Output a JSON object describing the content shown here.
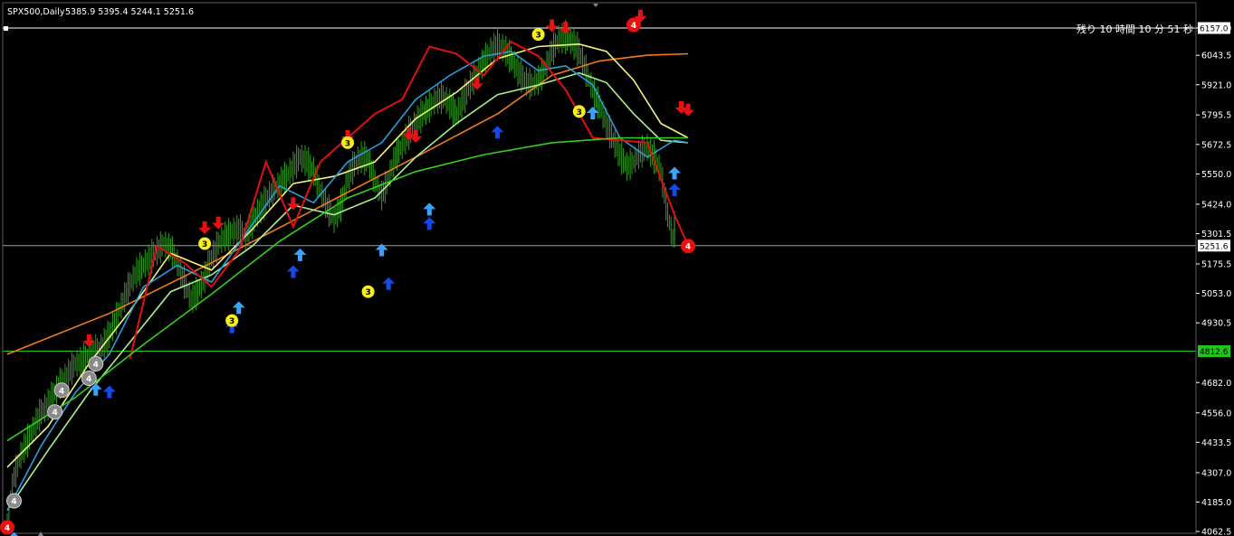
{
  "header": {
    "symbol": "SPX500,Daily",
    "ohlc": "5385.9 5395.4 5244.1 5251.6"
  },
  "timer": {
    "label": "残り 10 時間 10 分 51 秒"
  },
  "colors": {
    "background": "#000000",
    "bar": "#2f9e1c",
    "ma_orange": "#f07c1e",
    "ma_yellow": "#f5f27a",
    "ma_lightgreen": "#a8f08a",
    "ma_green": "#33d11a",
    "ma_blue": "#2a9de0",
    "ma_red": "#e01010",
    "arrow_up_light": "#3aa2ff",
    "arrow_up_dark": "#1448e8",
    "arrow_down": "#e81010",
    "badge_yellow": "#f7ef1a",
    "badge_red": "#e81010",
    "badge_gray": "#8a8a8a",
    "hline_gray": "#8ea6b8",
    "hline_green": "#22c51c"
  },
  "chart_data": {
    "type": "line",
    "title": "SPX500,Daily",
    "ylim": [
      4040,
      6200
    ],
    "y_ticks": [
      "6157.0",
      "6043.5",
      "5921.0",
      "5795.5",
      "5672.5",
      "5550.0",
      "5424.0",
      "5301.5",
      "5175.5",
      "5053.0",
      "4930.5",
      "4682.0",
      "4556.0",
      "4433.5",
      "4307.0",
      "4185.0",
      "4062.5"
    ],
    "price_tags": [
      {
        "label": "6157.0",
        "value": 6157.0,
        "style": "white"
      },
      {
        "label": "5251.6",
        "value": 5251.6,
        "style": "white"
      },
      {
        "label": "4812.6",
        "value": 4812.6,
        "style": "green"
      }
    ],
    "horizontal_lines": [
      {
        "value": 6157.0,
        "color": "#ffffff"
      },
      {
        "value": 5251.6,
        "color": "#8ea6b8"
      },
      {
        "value": 4812.6,
        "color": "#22c51c"
      }
    ],
    "close_series": [
      4110,
      4290,
      4380,
      4440,
      4500,
      4560,
      4590,
      4640,
      4690,
      4720,
      4760,
      4770,
      4800,
      4810,
      4830,
      4880,
      4950,
      5020,
      5090,
      5140,
      5170,
      5200,
      5230,
      5260,
      5240,
      5180,
      5100,
      5030,
      5060,
      5120,
      5200,
      5260,
      5290,
      5310,
      5320,
      5290,
      5350,
      5400,
      5440,
      5480,
      5510,
      5540,
      5580,
      5620,
      5600,
      5560,
      5480,
      5410,
      5360,
      5420,
      5530,
      5590,
      5620,
      5610,
      5520,
      5460,
      5530,
      5620,
      5670,
      5720,
      5760,
      5800,
      5830,
      5860,
      5870,
      5840,
      5800,
      5860,
      5920,
      5970,
      6020,
      6060,
      6090,
      6070,
      6030,
      5980,
      5940,
      5920,
      5940,
      5990,
      6060,
      6110,
      6120,
      6100,
      6060,
      5980,
      5900,
      5830,
      5760,
      5690,
      5630,
      5580,
      5600,
      5640,
      5660,
      5620,
      5560,
      5380,
      5251.6
    ],
    "series": [
      {
        "key": "ma_orange",
        "values": [
          [
            0,
            4800
          ],
          [
            15,
            4970
          ],
          [
            30,
            5180
          ],
          [
            45,
            5400
          ],
          [
            60,
            5620
          ],
          [
            72,
            5800
          ],
          [
            80,
            5960
          ],
          [
            87,
            6020
          ],
          [
            94,
            6044
          ],
          [
            100,
            6050
          ]
        ]
      },
      {
        "key": "ma_yellow",
        "values": [
          [
            0,
            4330
          ],
          [
            6,
            4500
          ],
          [
            12,
            4760
          ],
          [
            18,
            4980
          ],
          [
            24,
            5220
          ],
          [
            30,
            5150
          ],
          [
            36,
            5320
          ],
          [
            42,
            5510
          ],
          [
            48,
            5540
          ],
          [
            54,
            5600
          ],
          [
            60,
            5780
          ],
          [
            66,
            5890
          ],
          [
            72,
            6030
          ],
          [
            78,
            6080
          ],
          [
            84,
            6090
          ],
          [
            88,
            6060
          ],
          [
            92,
            5940
          ],
          [
            96,
            5760
          ],
          [
            100,
            5700
          ]
        ]
      },
      {
        "key": "ma_lightgreen",
        "values": [
          [
            0,
            4150
          ],
          [
            6,
            4400
          ],
          [
            12,
            4640
          ],
          [
            18,
            4850
          ],
          [
            24,
            5060
          ],
          [
            30,
            5130
          ],
          [
            36,
            5250
          ],
          [
            42,
            5420
          ],
          [
            48,
            5380
          ],
          [
            54,
            5450
          ],
          [
            60,
            5620
          ],
          [
            66,
            5760
          ],
          [
            72,
            5880
          ],
          [
            78,
            5920
          ],
          [
            84,
            5970
          ],
          [
            88,
            5930
          ],
          [
            92,
            5800
          ],
          [
            96,
            5690
          ],
          [
            100,
            5680
          ]
        ]
      },
      {
        "key": "ma_blue",
        "values": [
          [
            0,
            4150
          ],
          [
            5,
            4420
          ],
          [
            10,
            4640
          ],
          [
            15,
            4800
          ],
          [
            20,
            5080
          ],
          [
            25,
            5170
          ],
          [
            30,
            5100
          ],
          [
            35,
            5300
          ],
          [
            40,
            5500
          ],
          [
            45,
            5430
          ],
          [
            50,
            5600
          ],
          [
            55,
            5680
          ],
          [
            60,
            5860
          ],
          [
            65,
            5960
          ],
          [
            70,
            6040
          ],
          [
            74,
            6060
          ],
          [
            78,
            5980
          ],
          [
            82,
            6000
          ],
          [
            86,
            5920
          ],
          [
            90,
            5700
          ],
          [
            94,
            5620
          ],
          [
            98,
            5690
          ],
          [
            100,
            5680
          ]
        ]
      },
      {
        "key": "ma_red",
        "values": [
          [
            18,
            4780
          ],
          [
            22,
            5250
          ],
          [
            26,
            5180
          ],
          [
            30,
            5080
          ],
          [
            34,
            5230
          ],
          [
            38,
            5600
          ],
          [
            42,
            5330
          ],
          [
            46,
            5600
          ],
          [
            50,
            5700
          ],
          [
            54,
            5800
          ],
          [
            58,
            5860
          ],
          [
            62,
            6080
          ],
          [
            66,
            6050
          ],
          [
            70,
            5960
          ],
          [
            74,
            6100
          ],
          [
            78,
            6040
          ],
          [
            82,
            5900
          ],
          [
            86,
            5700
          ],
          [
            90,
            5690
          ],
          [
            94,
            5680
          ],
          [
            98,
            5380
          ],
          [
            100,
            5251.6
          ]
        ]
      },
      {
        "key": "ma_green",
        "values": [
          [
            0,
            4440
          ],
          [
            10,
            4620
          ],
          [
            20,
            4840
          ],
          [
            30,
            5050
          ],
          [
            40,
            5270
          ],
          [
            50,
            5450
          ],
          [
            60,
            5560
          ],
          [
            70,
            5630
          ],
          [
            80,
            5680
          ],
          [
            90,
            5700
          ],
          [
            100,
            5700
          ]
        ]
      }
    ],
    "markers": [
      {
        "type": "up_light",
        "i": 1,
        "v": 4060
      },
      {
        "type": "up_light",
        "i": 13,
        "v": 4680
      },
      {
        "type": "up_dark",
        "i": 15,
        "v": 4670
      },
      {
        "type": "down",
        "i": 12,
        "v": 4830
      },
      {
        "type": "down",
        "i": 29,
        "v": 5300
      },
      {
        "type": "down",
        "i": 31,
        "v": 5320
      },
      {
        "type": "up_light",
        "i": 34,
        "v": 5020
      },
      {
        "type": "up_dark",
        "i": 33,
        "v": 4940
      },
      {
        "type": "down",
        "i": 42,
        "v": 5400
      },
      {
        "type": "up_light",
        "i": 43,
        "v": 5240
      },
      {
        "type": "up_dark",
        "i": 42,
        "v": 5170
      },
      {
        "type": "down",
        "i": 50,
        "v": 5680
      },
      {
        "type": "up_light",
        "i": 55,
        "v": 5260
      },
      {
        "type": "up_dark",
        "i": 56,
        "v": 5120
      },
      {
        "type": "down",
        "i": 59,
        "v": 5690
      },
      {
        "type": "down",
        "i": 60,
        "v": 5680
      },
      {
        "type": "up_light",
        "i": 62,
        "v": 5430
      },
      {
        "type": "up_dark",
        "i": 62,
        "v": 5370
      },
      {
        "type": "down",
        "i": 69,
        "v": 5900
      },
      {
        "type": "up_dark",
        "i": 72,
        "v": 5750
      },
      {
        "type": "down",
        "i": 80,
        "v": 6140
      },
      {
        "type": "down",
        "i": 82,
        "v": 6130
      },
      {
        "type": "up_light",
        "i": 86,
        "v": 5830
      },
      {
        "type": "down",
        "i": 93,
        "v": 6180
      },
      {
        "type": "down",
        "i": 99,
        "v": 5800
      },
      {
        "type": "down",
        "i": 100,
        "v": 5790
      },
      {
        "type": "up_light",
        "i": 98,
        "v": 5580
      },
      {
        "type": "up_dark",
        "i": 98,
        "v": 5510
      }
    ],
    "badges": [
      {
        "label": "3",
        "color": "yellow",
        "i": 29,
        "v": 5260
      },
      {
        "label": "3",
        "color": "yellow",
        "i": 33,
        "v": 4940
      },
      {
        "label": "3",
        "color": "yellow",
        "i": 50,
        "v": 5680
      },
      {
        "label": "3",
        "color": "yellow",
        "i": 53,
        "v": 5060
      },
      {
        "label": "3",
        "color": "yellow",
        "i": 78,
        "v": 6130
      },
      {
        "label": "3",
        "color": "yellow",
        "i": 84,
        "v": 5810
      },
      {
        "label": "4",
        "color": "gray",
        "i": 8,
        "v": 4650
      },
      {
        "label": "4",
        "color": "gray",
        "i": 13,
        "v": 4760
      },
      {
        "label": "4",
        "color": "gray",
        "i": 7,
        "v": 4560
      },
      {
        "label": "4",
        "color": "gray",
        "i": 12,
        "v": 4700
      },
      {
        "label": "4",
        "color": "gray",
        "i": 1,
        "v": 4190
      },
      {
        "label": "4",
        "color": "red",
        "i": 92,
        "v": 6170
      },
      {
        "label": "4",
        "color": "red",
        "i": 100,
        "v": 5250
      },
      {
        "label": "4",
        "color": "red",
        "i": 0,
        "v": 4080
      }
    ]
  }
}
